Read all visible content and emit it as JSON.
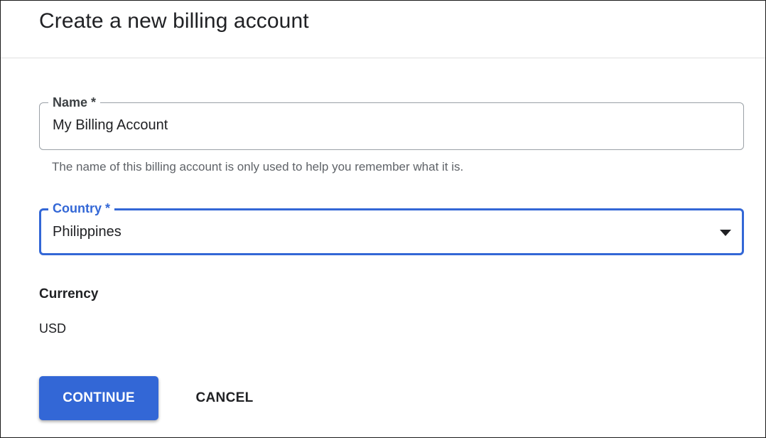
{
  "dialog": {
    "title": "Create a new billing account"
  },
  "name_field": {
    "label": "Name *",
    "value": "My Billing Account",
    "helper": "The name of this billing account is only used to help you remember what it is."
  },
  "country_field": {
    "label": "Country *",
    "value": "Philippines",
    "icon": "dropdown-arrow-icon"
  },
  "currency": {
    "label": "Currency",
    "value": "USD"
  },
  "actions": {
    "continue_label": "CONTINUE",
    "cancel_label": "CANCEL"
  },
  "colors": {
    "accent": "#3367d6",
    "text": "#202124",
    "helper_text": "#5f6368",
    "border": "#9aa0a6",
    "divider": "#e0e0e0"
  }
}
